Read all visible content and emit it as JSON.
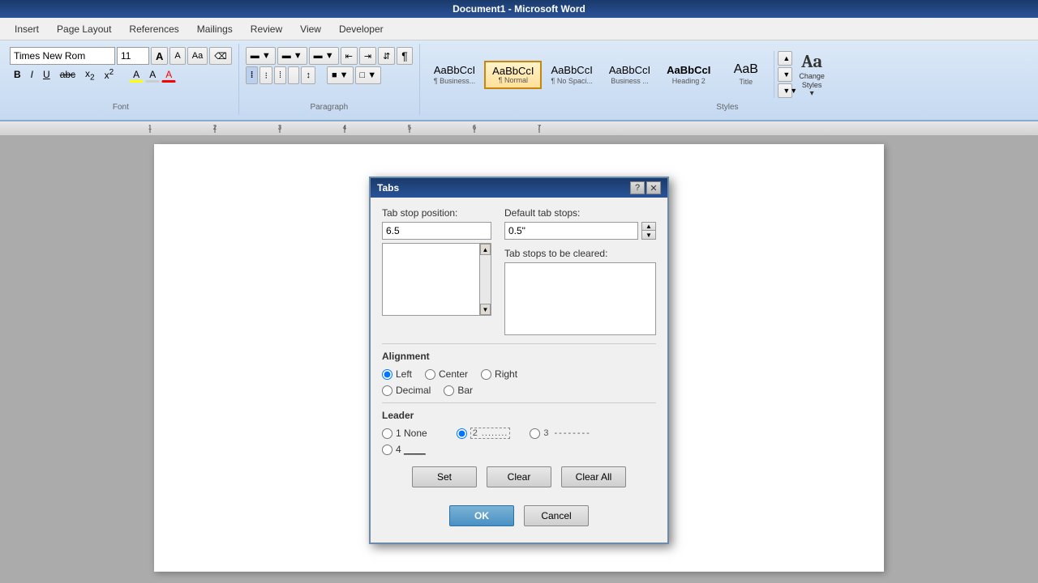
{
  "titlebar": {
    "text": "Document1 - Microsoft Word"
  },
  "menu": {
    "items": [
      "Insert",
      "Page Layout",
      "References",
      "Mailings",
      "Review",
      "View",
      "Developer"
    ]
  },
  "ribbon": {
    "font": {
      "name": "Times New Rom",
      "size": "11",
      "label": "Font"
    },
    "paragraph": {
      "label": "Paragraph"
    },
    "styles": {
      "label": "Styles",
      "items": [
        {
          "id": "business1",
          "preview": "AaBbCcI",
          "name": "¶ Business...",
          "highlighted": false
        },
        {
          "id": "normal",
          "preview": "AaBbCcI",
          "name": "¶ Normal",
          "highlighted": true
        },
        {
          "id": "nospace",
          "preview": "AaBbCcI",
          "name": "¶ No Spaci...",
          "highlighted": false
        },
        {
          "id": "business2",
          "preview": "AaBbCcI",
          "name": "Business ...",
          "highlighted": false
        },
        {
          "id": "heading2",
          "preview": "AaBbCcI",
          "name": "Heading 2",
          "highlighted": false
        },
        {
          "id": "title",
          "preview": "AaB",
          "name": "Title",
          "highlighted": false
        }
      ],
      "changeStyles": "Change\nStyles"
    }
  },
  "dialog": {
    "title": "Tabs",
    "tabStopPosition": {
      "label": "Tab stop position:",
      "value": "6.5"
    },
    "defaultTabStop": {
      "label": "Default tab stops:",
      "value": "0.5\""
    },
    "tabStopsToBeCleared": {
      "label": "Tab stops to be cleared:"
    },
    "alignment": {
      "heading": "Alignment",
      "options": [
        {
          "id": "left",
          "label": "Left",
          "checked": true
        },
        {
          "id": "center",
          "label": "Center",
          "checked": false
        },
        {
          "id": "right",
          "label": "Right",
          "checked": false
        },
        {
          "id": "decimal",
          "label": "Decimal",
          "checked": false
        },
        {
          "id": "bar",
          "label": "Bar",
          "checked": false
        }
      ]
    },
    "leader": {
      "heading": "Leader",
      "options": [
        {
          "id": "none",
          "label": "1 None",
          "checked": false
        },
        {
          "id": "dots",
          "label": "2 ........",
          "checked": true
        },
        {
          "id": "dashes",
          "label": "3 --------",
          "checked": false
        },
        {
          "id": "underline",
          "label": "4 ____",
          "checked": false
        }
      ]
    },
    "buttons": {
      "set": "Set",
      "clear": "Clear",
      "clearAll": "Clear All",
      "ok": "OK",
      "cancel": "Cancel"
    }
  }
}
